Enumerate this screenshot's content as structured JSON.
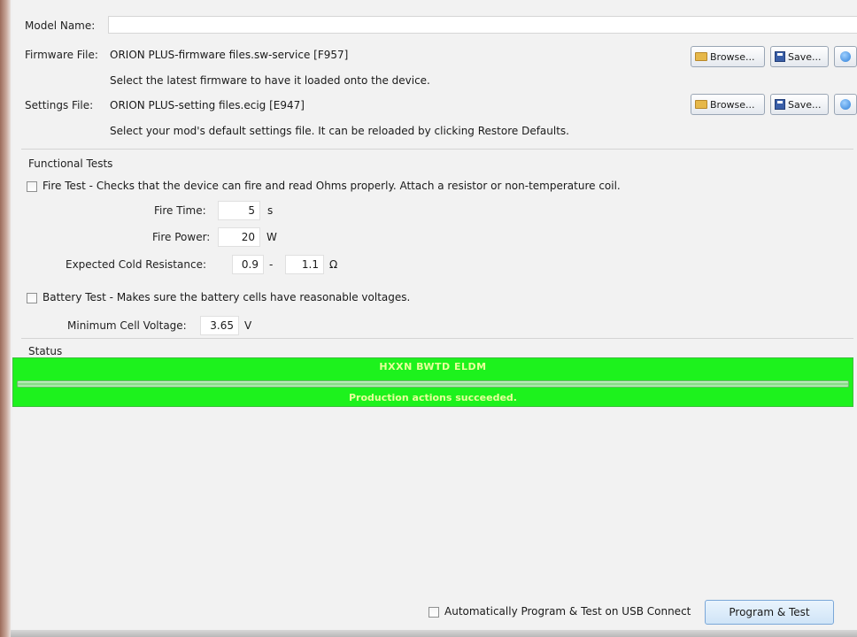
{
  "model_name": {
    "label": "Model Name:",
    "value": ""
  },
  "firmware": {
    "label": "Firmware File:",
    "file": "ORION PLUS-firmware files.sw-service [F957]",
    "hint": "Select the latest firmware to have it loaded onto the device.",
    "browse_label": "Browse...",
    "save_label": "Save..."
  },
  "settings": {
    "label": "Settings File:",
    "file": "ORION PLUS-setting files.ecig [E947]",
    "hint": "Select your mod's default settings file. It can be reloaded by clicking Restore Defaults.",
    "browse_label": "Browse...",
    "save_label": "Save..."
  },
  "functional_tests": {
    "title": "Functional Tests",
    "fire_test": {
      "label": "Fire Test - Checks that the device can fire and read Ohms properly. Attach a resistor or non-temperature coil.",
      "checked": false,
      "fire_time": {
        "label": "Fire Time:",
        "value": "5",
        "unit": "s"
      },
      "fire_power": {
        "label": "Fire Power:",
        "value": "20",
        "unit": "W"
      },
      "cold_resistance": {
        "label": "Expected Cold Resistance:",
        "min": "0.9",
        "separator": "-",
        "max": "1.1",
        "unit": "Ω"
      }
    },
    "battery_test": {
      "label": "Battery Test - Makes sure the battery cells have reasonable voltages.",
      "checked": false,
      "min_cell_voltage": {
        "label": "Minimum Cell Voltage:",
        "value": "3.65",
        "unit": "V"
      }
    }
  },
  "status": {
    "title": "Status",
    "device_id": "HXXN BWTD ELDM",
    "progress": 1.0,
    "message": "Production actions succeeded.",
    "color": "#1df21d"
  },
  "footer": {
    "auto_label": "Automatically Program & Test on USB Connect",
    "auto_checked": false,
    "program_button": "Program & Test"
  }
}
